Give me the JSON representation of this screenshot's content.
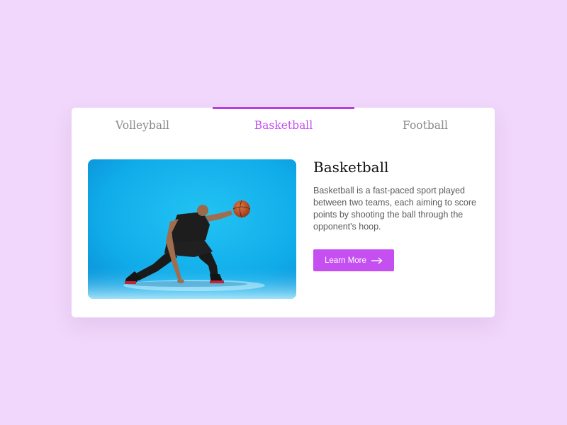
{
  "tabs": [
    {
      "label": "Volleyball",
      "active": false
    },
    {
      "label": "Basketball",
      "active": true
    },
    {
      "label": "Football",
      "active": false
    }
  ],
  "panel": {
    "image_icon": "basketball-player-photo",
    "title": "Basketball",
    "description": "Basketball is a fast-paced sport played between two teams, each aiming to score points by shooting the ball through the opponent's hoop.",
    "button_label": "Learn More",
    "button_icon": "arrow-right-icon"
  },
  "colors": {
    "page_background": "#f1d7fb",
    "accent": "#c64ff2",
    "tab_indicator": "#b73fe2",
    "inactive_tab": "#8a8a8a",
    "photo_background": "#14b3ea"
  }
}
